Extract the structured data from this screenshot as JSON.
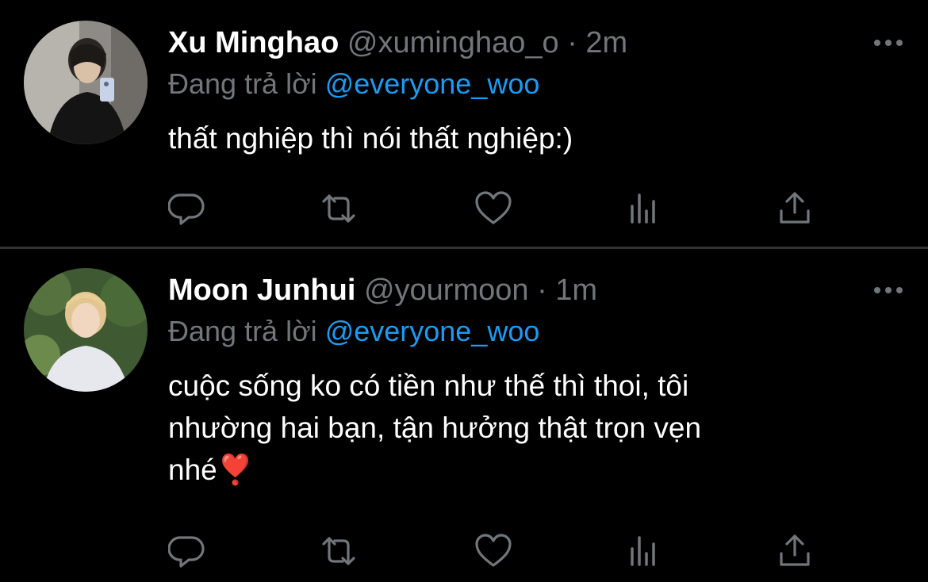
{
  "tweets": [
    {
      "name": "Xu Minghao",
      "handle": "@xuminghao_o",
      "separator": "·",
      "time": "2m",
      "replying_prefix": "Đang trả lời ",
      "replying_to": "@everyone_woo",
      "lines": [
        "thất nghiệp thì nói thất nghiệp:)"
      ],
      "icons": [
        "reply-icon",
        "retweet-icon",
        "like-icon",
        "views-icon",
        "share-icon"
      ]
    },
    {
      "name": "Moon Junhui",
      "handle": "@yourmoon",
      "separator": "·",
      "time": "1m",
      "replying_prefix": "Đang trả lời ",
      "replying_to": "@everyone_woo",
      "lines": [
        "cuộc sống ko có tiền như thế thì thoi, tôi",
        "nhường hai bạn, tận hưởng thật trọn vẹn",
        "nhé❣️"
      ],
      "icons": [
        "reply-icon",
        "retweet-icon",
        "like-icon",
        "views-icon",
        "share-icon"
      ]
    }
  ],
  "colors": {
    "background": "#000000",
    "text": "#ffffff",
    "secondary": "#71767b",
    "mention": "#1d9bf0",
    "divider": "#2f3336"
  }
}
